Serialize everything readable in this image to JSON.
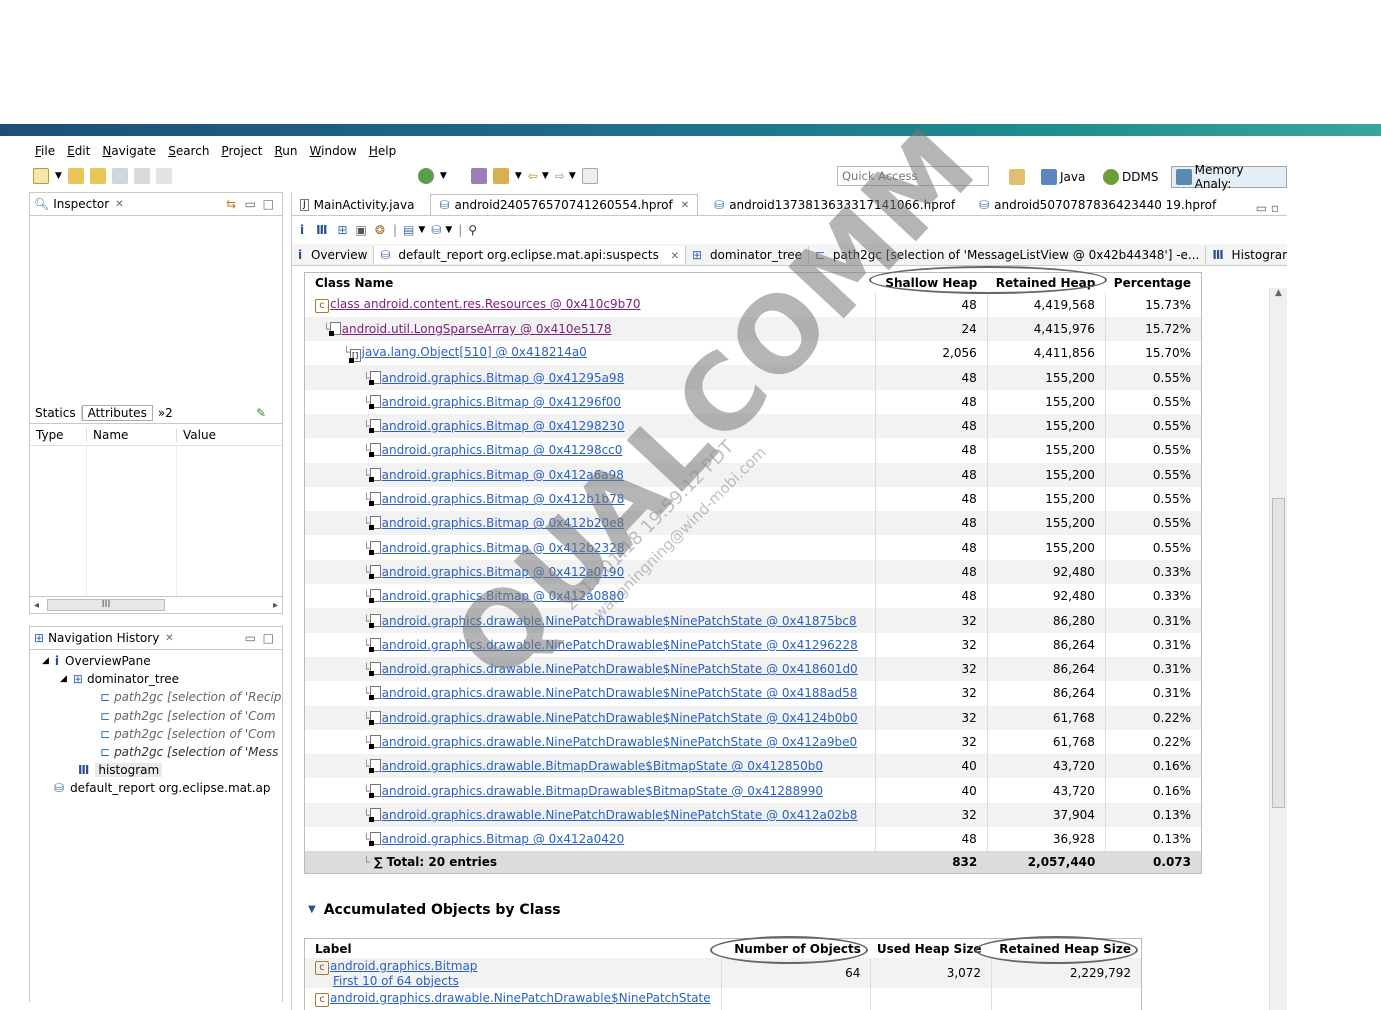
{
  "menu": [
    "File",
    "Edit",
    "Navigate",
    "Search",
    "Project",
    "Run",
    "Window",
    "Help"
  ],
  "toolbar": {
    "quick_access_placeholder": "Quick Access",
    "perspectives": [
      "Java",
      "DDMS",
      "Memory Analy:"
    ]
  },
  "inspector": {
    "title": "Inspector",
    "tabs": [
      "Statics",
      "Attributes",
      "»2"
    ],
    "columns": [
      "Type",
      "Name",
      "Value"
    ],
    "hscroll_label": "III"
  },
  "nav_history": {
    "title": "Navigation History",
    "items": [
      {
        "label": "OverviewPane",
        "level": 0,
        "style": "normal"
      },
      {
        "label": "dominator_tree",
        "level": 1,
        "style": "normal"
      },
      {
        "label": "path2gc [selection of 'Recip",
        "level": 2,
        "style": "italic"
      },
      {
        "label": "path2gc [selection of 'Com",
        "level": 2,
        "style": "italic"
      },
      {
        "label": "path2gc [selection of 'Com",
        "level": 2,
        "style": "italic"
      },
      {
        "label": "path2gc [selection of 'Mess",
        "level": 2,
        "style": "italic"
      },
      {
        "label": "histogram",
        "level": 1,
        "style": "normal"
      },
      {
        "label": "default_report  org.eclipse.mat.ap",
        "level": 0,
        "style": "normal"
      }
    ]
  },
  "editor_tabs": [
    {
      "label": "MainActivity.java",
      "active": false
    },
    {
      "label": "android240576570741260554.hprof",
      "active": true
    },
    {
      "label": "android1373813633317141066.hprof",
      "active": false
    },
    {
      "label": "android5070787836423440 19.hprof",
      "active": false
    }
  ],
  "sub_tabs": [
    {
      "label": "Overview"
    },
    {
      "label": "default_report  org.eclipse.mat.api:suspects"
    },
    {
      "label": "dominator_tree"
    },
    {
      "label": "path2gc [selection of 'MessageListView @ 0x42b44348'] -e..."
    },
    {
      "label": "Histogram"
    }
  ],
  "table": {
    "headers": [
      "Class Name",
      "Shallow Heap",
      "Retained Heap",
      "Percentage"
    ],
    "rows": [
      {
        "name": "class android.content.res.Resources @ 0x410c9b70",
        "shallow": "48",
        "retained": "4,419,568",
        "pct": "15.73%",
        "indent": 0,
        "kind": "class"
      },
      {
        "name": "android.util.LongSparseArray @ 0x410e5178",
        "shallow": "24",
        "retained": "4,415,976",
        "pct": "15.72%",
        "indent": 1,
        "kind": "obj-purple"
      },
      {
        "name": "java.lang.Object[510] @ 0x418214a0",
        "shallow": "2,056",
        "retained": "4,411,856",
        "pct": "15.70%",
        "indent": 2,
        "kind": "arr"
      },
      {
        "name": "android.graphics.Bitmap @ 0x41295a98",
        "shallow": "48",
        "retained": "155,200",
        "pct": "0.55%",
        "indent": 3,
        "kind": "obj"
      },
      {
        "name": "android.graphics.Bitmap @ 0x41296f00",
        "shallow": "48",
        "retained": "155,200",
        "pct": "0.55%",
        "indent": 3,
        "kind": "obj"
      },
      {
        "name": "android.graphics.Bitmap @ 0x41298230",
        "shallow": "48",
        "retained": "155,200",
        "pct": "0.55%",
        "indent": 3,
        "kind": "obj"
      },
      {
        "name": "android.graphics.Bitmap @ 0x41298cc0",
        "shallow": "48",
        "retained": "155,200",
        "pct": "0.55%",
        "indent": 3,
        "kind": "obj"
      },
      {
        "name": "android.graphics.Bitmap @ 0x412a6a98",
        "shallow": "48",
        "retained": "155,200",
        "pct": "0.55%",
        "indent": 3,
        "kind": "obj"
      },
      {
        "name": "android.graphics.Bitmap @ 0x412b1b78",
        "shallow": "48",
        "retained": "155,200",
        "pct": "0.55%",
        "indent": 3,
        "kind": "obj"
      },
      {
        "name": "android.graphics.Bitmap @ 0x412b20e8",
        "shallow": "48",
        "retained": "155,200",
        "pct": "0.55%",
        "indent": 3,
        "kind": "obj"
      },
      {
        "name": "android.graphics.Bitmap @ 0x412b2328",
        "shallow": "48",
        "retained": "155,200",
        "pct": "0.55%",
        "indent": 3,
        "kind": "obj"
      },
      {
        "name": "android.graphics.Bitmap @ 0x412a0190",
        "shallow": "48",
        "retained": "92,480",
        "pct": "0.33%",
        "indent": 3,
        "kind": "obj"
      },
      {
        "name": "android.graphics.Bitmap @ 0x412a0880",
        "shallow": "48",
        "retained": "92,480",
        "pct": "0.33%",
        "indent": 3,
        "kind": "obj"
      },
      {
        "name": "android.graphics.drawable.NinePatchDrawable$NinePatchState @ 0x41875bc8",
        "shallow": "32",
        "retained": "86,280",
        "pct": "0.31%",
        "indent": 3,
        "kind": "obj"
      },
      {
        "name": "android.graphics.drawable.NinePatchDrawable$NinePatchState @ 0x41296228",
        "shallow": "32",
        "retained": "86,264",
        "pct": "0.31%",
        "indent": 3,
        "kind": "obj"
      },
      {
        "name": "android.graphics.drawable.NinePatchDrawable$NinePatchState @ 0x418601d0",
        "shallow": "32",
        "retained": "86,264",
        "pct": "0.31%",
        "indent": 3,
        "kind": "obj"
      },
      {
        "name": "android.graphics.drawable.NinePatchDrawable$NinePatchState @ 0x4188ad58",
        "shallow": "32",
        "retained": "86,264",
        "pct": "0.31%",
        "indent": 3,
        "kind": "obj"
      },
      {
        "name": "android.graphics.drawable.NinePatchDrawable$NinePatchState @ 0x4124b0b0",
        "shallow": "32",
        "retained": "61,768",
        "pct": "0.22%",
        "indent": 3,
        "kind": "obj"
      },
      {
        "name": "android.graphics.drawable.NinePatchDrawable$NinePatchState @ 0x412a9be0",
        "shallow": "32",
        "retained": "61,768",
        "pct": "0.22%",
        "indent": 3,
        "kind": "obj"
      },
      {
        "name": "android.graphics.drawable.BitmapDrawable$BitmapState @ 0x412850b0",
        "shallow": "40",
        "retained": "43,720",
        "pct": "0.16%",
        "indent": 3,
        "kind": "obj"
      },
      {
        "name": "android.graphics.drawable.BitmapDrawable$BitmapState @ 0x41288990",
        "shallow": "40",
        "retained": "43,720",
        "pct": "0.16%",
        "indent": 3,
        "kind": "obj"
      },
      {
        "name": "android.graphics.drawable.NinePatchDrawable$NinePatchState @ 0x412a02b8",
        "shallow": "32",
        "retained": "37,904",
        "pct": "0.13%",
        "indent": 3,
        "kind": "obj"
      },
      {
        "name": "android.graphics.Bitmap @ 0x412a0420",
        "shallow": "48",
        "retained": "36,928",
        "pct": "0.13%",
        "indent": 3,
        "kind": "obj"
      }
    ],
    "total": {
      "label": "∑ Total: 20 entries",
      "shallow": "832",
      "retained": "2,057,440",
      "pct": "0.073"
    }
  },
  "accumulated": {
    "title": "Accumulated Objects by Class",
    "headers": [
      "Label",
      "Number of Objects",
      "Used Heap Size",
      "Retained Heap Size"
    ],
    "rows": [
      {
        "label": "android.graphics.Bitmap",
        "sub": "First 10 of 64 objects",
        "count": "64",
        "used": "3,072",
        "retained": "2,229,792"
      },
      {
        "label": "android.graphics.drawable.NinePatchDrawable$NinePatchState",
        "sub": "",
        "count": "",
        "used": "",
        "retained": ""
      }
    ]
  },
  "watermark": {
    "brand": "QUALCOMM",
    "line1": "2017.01.18 19:59:12 PDT",
    "line2": "wangningning@wind-mobi.com"
  }
}
